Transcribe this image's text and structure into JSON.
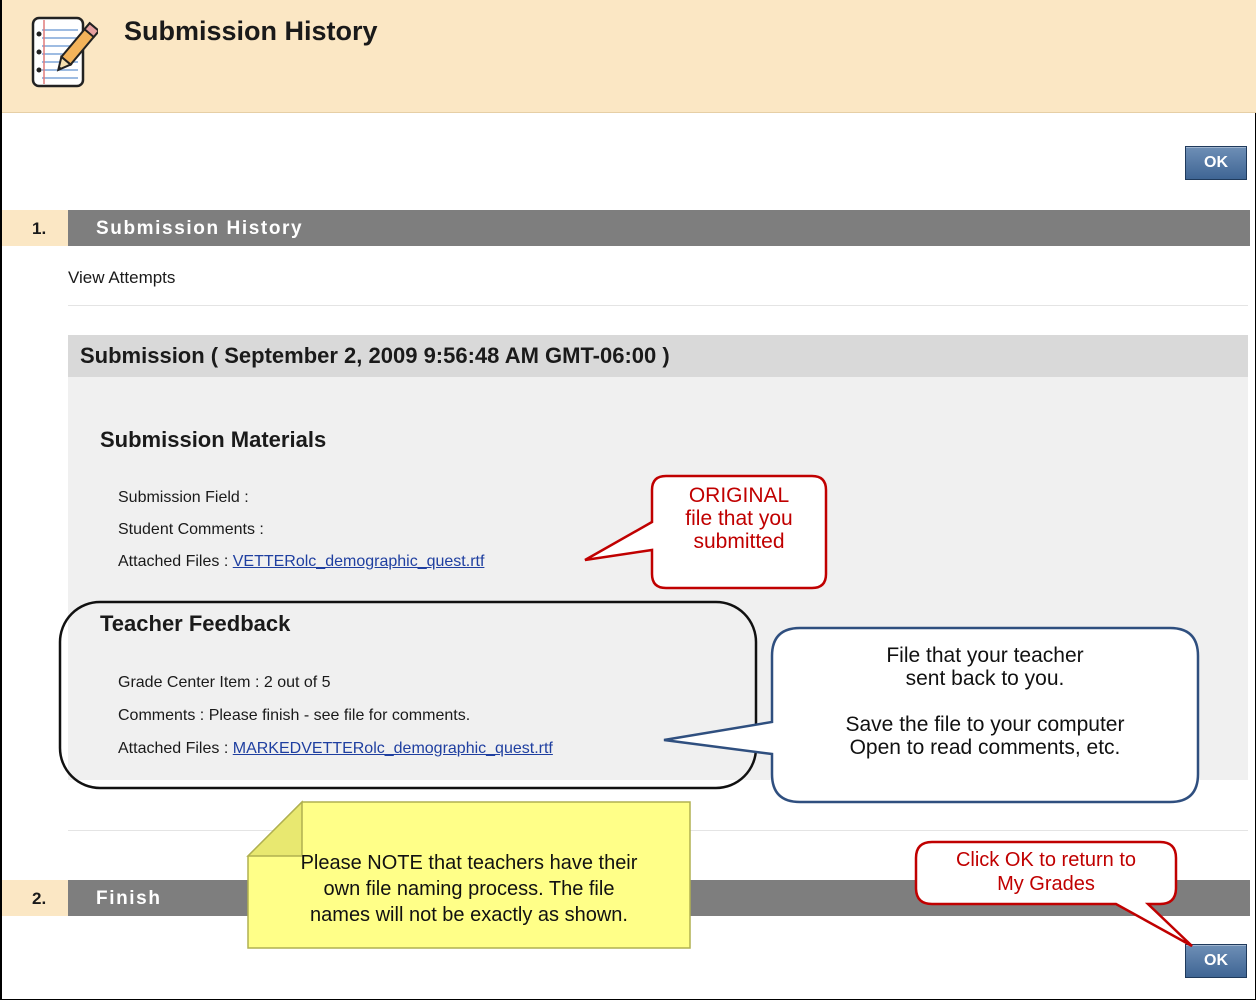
{
  "header": {
    "title": "Submission History",
    "icon": "notepad-pencil-icon"
  },
  "buttons": {
    "ok_label": "OK"
  },
  "steps": [
    {
      "number": "1.",
      "label": "Submission History"
    },
    {
      "number": "2.",
      "label": "Finish"
    }
  ],
  "view_attempts": "View Attempts",
  "submission": {
    "header": "Submission ( September 2, 2009 9:56:48 AM GMT-06:00 )",
    "materials_heading": "Submission Materials",
    "submission_field_label": "Submission Field :",
    "student_comments_label": "Student Comments :",
    "attached_files_label": "Attached Files :",
    "attached_file": "VETTERolc_demographic_quest.rtf",
    "feedback_heading": "Teacher Feedback",
    "grade_label": "Grade Center Item :",
    "grade_value": "2 out of 5",
    "comments_label": "Comments :",
    "comments_value": "Please finish - see file for comments.",
    "feedback_attached_label": "Attached Files :",
    "feedback_file": "MARKEDVETTERolc_demographic_quest.rtf"
  },
  "callouts": {
    "original": [
      "ORIGINAL",
      "file that you",
      "submitted"
    ],
    "teacher_file": [
      "File that your teacher",
      "sent back to you.",
      "",
      "Save the file to your computer",
      "Open to read comments, etc."
    ],
    "note": [
      "Please NOTE that teachers have their",
      "own file naming process.  The file",
      "names will not be exactly as shown."
    ],
    "click_ok": [
      "Click OK to return to",
      "My Grades"
    ]
  },
  "colors": {
    "header_bg": "#fbe7c4",
    "step_bar": "#7e7e7e",
    "ok_button": "#4a6c98",
    "callout_red": "#c00000",
    "callout_blue": "#2f4f7f",
    "note_yellow": "#ffff88"
  }
}
